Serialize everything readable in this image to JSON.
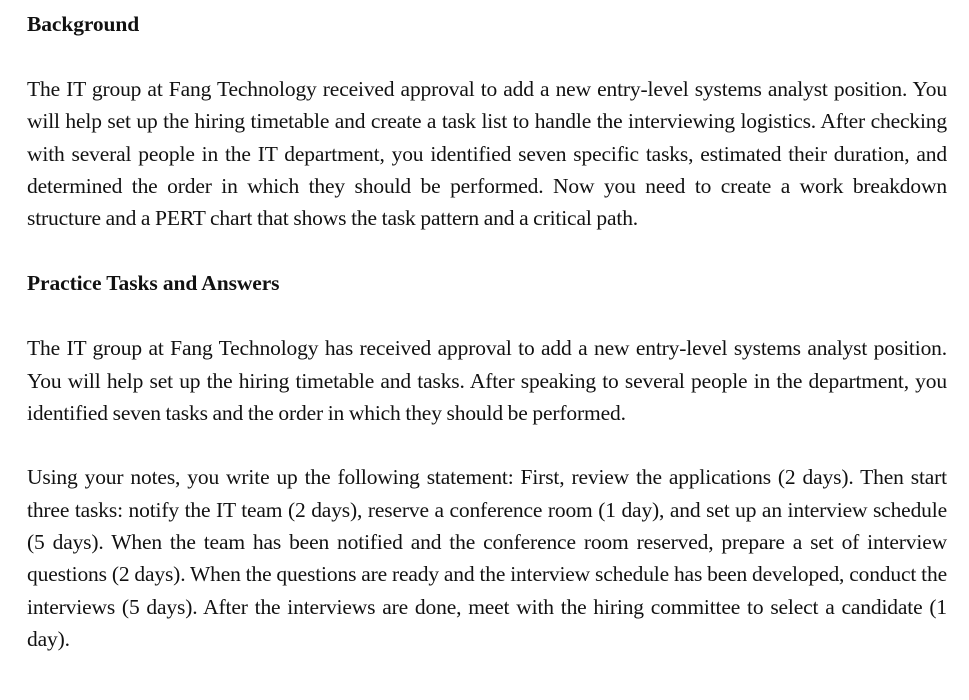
{
  "sections": [
    {
      "heading": "Background",
      "paragraphs": [
        "The IT group at Fang Technology received approval to add a new entry-level systems analyst position. You will help set up the hiring timetable and create a task list to handle the interviewing logistics. After checking with several people in the IT department, you identified seven specific tasks, estimated their duration, and determined the order in which they should be performed. Now you need to create a work breakdown structure and a PERT chart that shows the task pattern and a critical path."
      ]
    },
    {
      "heading": "Practice Tasks and Answers",
      "paragraphs": [
        "The IT group at Fang Technology has received approval to add a new entry-level systems analyst position. You will help set up the hiring timetable and tasks. After speaking to several people in the department, you identified seven tasks and the order in which they should be performed.",
        "Using your notes, you write up the following statement: First, review the applications (2 days). Then start three tasks: notify the IT team (2 days), reserve a conference room (1 day), and set up an interview schedule (5 days). When the team has been notified and the conference room reserved, prepare a set of interview questions (2 days). When the questions are ready and the interview schedule has been developed, conduct the interviews (5 days). After the interviews are done, meet with the hiring committee to select a candidate (1 day)."
      ]
    }
  ]
}
